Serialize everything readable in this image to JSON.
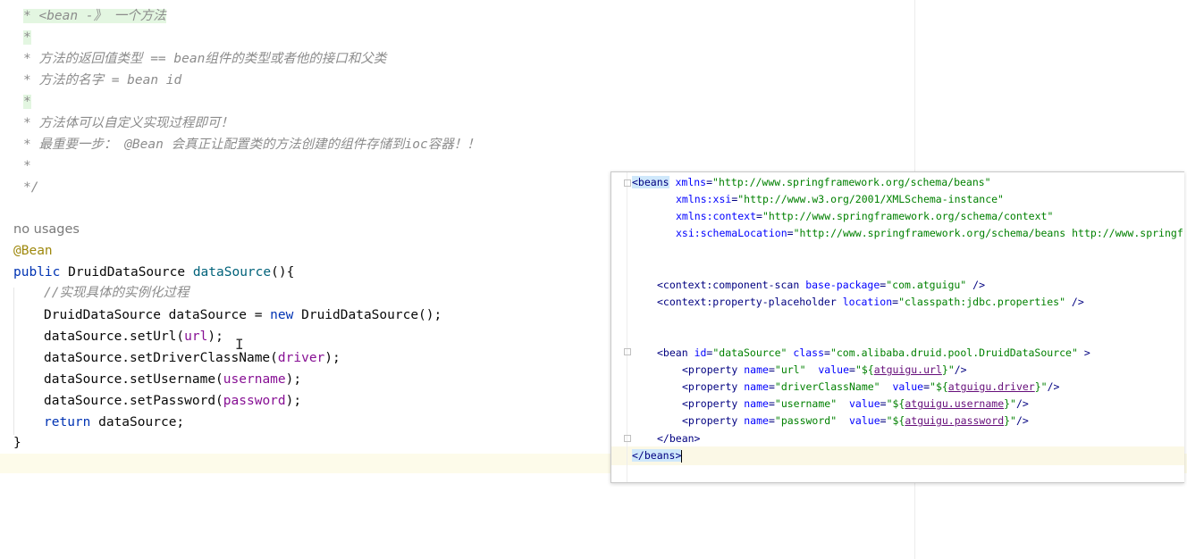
{
  "doc_comment": {
    "line1": "* <bean -》 一个方法",
    "line2": "*",
    "line3": "* 方法的返回值类型 == bean组件的类型或者他的接口和父类",
    "line4": "* 方法的名字 = bean id",
    "line5": "*",
    "line6": "* 方法体可以自定义实现过程即可！",
    "line7": "* 最重要一步： @Bean 会真正让配置类的方法创建的组件存储到ioc容器！！",
    "line8": "*",
    "line9": "*/"
  },
  "java": {
    "usages": "no usages",
    "annotation": "@Bean",
    "kw_public": "public",
    "return_type": "DruidDataSource",
    "method_name": "dataSource",
    "open_sig": "(){",
    "comment": "//实现具体的实例化过程",
    "line_decl_type": "DruidDataSource dataSource = ",
    "kw_new": "new",
    "line_decl_ctor": " DruidDataSource();",
    "set_url": "dataSource.setUrl(",
    "p_url": "url",
    "set_driver": "dataSource.setDriverClassName(",
    "p_driver": "driver",
    "set_username": "dataSource.setUsername(",
    "p_username": "username",
    "set_password": "dataSource.setPassword(",
    "p_password": "password",
    "close_call": ");",
    "kw_return": "return",
    "return_val": " dataSource;",
    "close_brace": "}"
  },
  "xml": {
    "beans_open": "<beans",
    "xmlns_attr": "xmlns",
    "xmlns_val": "\"http://www.springframework.org/schema/beans\"",
    "xsi_attr": "xmlns:xsi",
    "xsi_val": "\"http://www.w3.org/2001/XMLSchema-instance\"",
    "ctx_attr": "xmlns:context",
    "ctx_val": "\"http://www.springframework.org/schema/context\"",
    "schema_attr": "xsi:schemaLocation",
    "schema_val": "\"http://www.springframework.org/schema/beans http://www.springf",
    "scan_tag": "<context:component-scan",
    "scan_attr": "base-package",
    "scan_val": "\"com.atguigu\"",
    "self_close": " />",
    "ph_tag": "<context:property-placeholder",
    "ph_attr": "location",
    "ph_val": "\"classpath:jdbc.properties\"",
    "bean_tag": "<bean",
    "bean_id_attr": "id",
    "bean_id_val": "\"dataSource\"",
    "bean_class_attr": "class",
    "bean_class_val": "\"com.alibaba.druid.pool.DruidDataSource\"",
    "bean_close": " >",
    "prop_tag": "<property",
    "name_attr": "name",
    "value_attr": "value",
    "p1_name": "\"url\"",
    "p1_value_pre": "\"${",
    "p1_value_key": "atguigu.url",
    "p2_name": "\"driverClassName\"",
    "p2_value_key": "atguigu.driver",
    "p3_name": "\"username\"",
    "p3_value_key": "atguigu.username",
    "p4_name": "\"password\"",
    "p4_value_key": "atguigu.password",
    "value_post": "}\"",
    "prop_end": "/>",
    "bean_end": "</bean>",
    "beans_end": "</beans>"
  },
  "colors": {
    "keyword": "#0033b3",
    "annotation": "#9e880d",
    "method": "#00627a",
    "parameter": "#871094",
    "comment": "#8c8c8c",
    "xml_tag": "#000080",
    "xml_attr": "#0000ff",
    "xml_value": "#008000"
  }
}
